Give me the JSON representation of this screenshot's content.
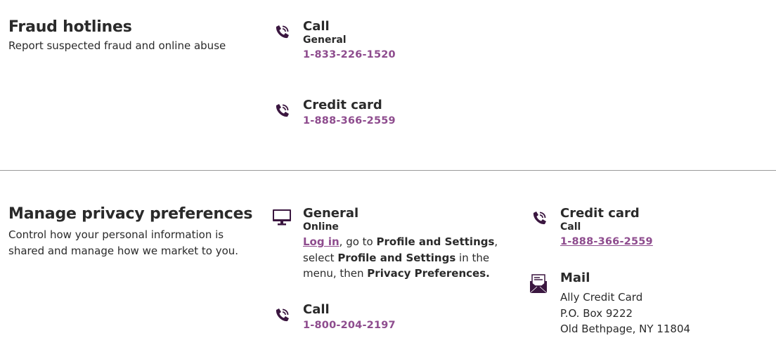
{
  "fraud": {
    "title": "Fraud hotlines",
    "subtitle": "Report suspected fraud and online abuse",
    "call": {
      "title": "Call",
      "subtitle": "General",
      "phone": "1-833-226-1520"
    },
    "credit": {
      "title": "Credit card",
      "phone": "1-888-366-2559"
    }
  },
  "privacy": {
    "title": "Manage privacy preferences",
    "subtitle_line1": "Control how your personal information is",
    "subtitle_line2": "shared and manage how we market to you.",
    "general": {
      "title": "General",
      "subtitle": "Online",
      "login_link": "Log in",
      "text_1": ", go to ",
      "bold_1": "Profile and Settings",
      "text_2": ",",
      "text_3": "select ",
      "bold_2": "Profile and Settings",
      "text_4": " in the",
      "text_5": "menu, then ",
      "bold_3": "Privacy Preferences."
    },
    "call": {
      "title": "Call",
      "phone": "1-800-204-2197"
    },
    "credit": {
      "title": "Credit card",
      "subtitle": "Call",
      "phone": "1-888-366-2559"
    },
    "mail": {
      "title": "Mail",
      "line1": "Ally Credit Card",
      "line2": "P.O. Box 9222",
      "line3": "Old Bethpage, NY 11804"
    }
  },
  "colors": {
    "accent": "#8e4c8e",
    "icon": "#3b1740",
    "text": "#2a2a2a",
    "divider": "#9a9a9a"
  },
  "icons": [
    "phone-icon",
    "monitor-icon",
    "mail-envelope-icon"
  ]
}
